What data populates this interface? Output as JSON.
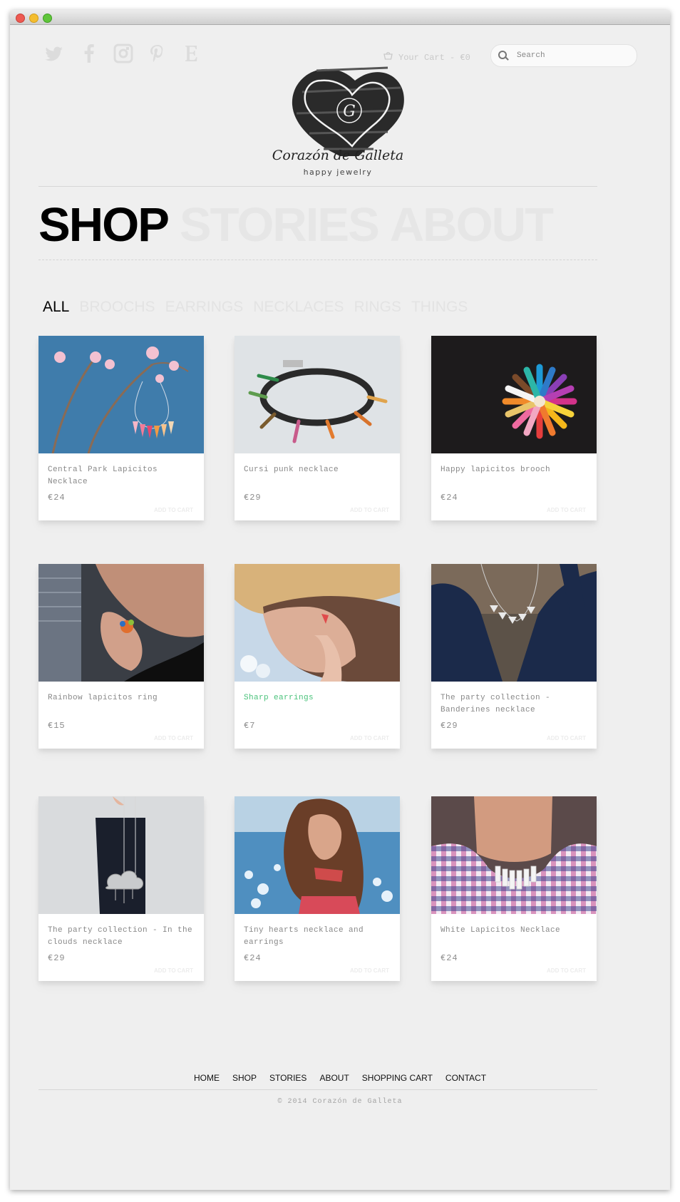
{
  "social": [
    {
      "icon": "twitter-icon",
      "glyph": "t"
    },
    {
      "icon": "facebook-icon",
      "glyph": "f"
    },
    {
      "icon": "instagram-icon",
      "glyph": "◘"
    },
    {
      "icon": "pinterest-icon",
      "glyph": "p"
    },
    {
      "icon": "etsy-icon",
      "glyph": "E"
    }
  ],
  "cart": {
    "label": "Your Cart - €0",
    "icon": "basket-icon"
  },
  "search": {
    "placeholder": "Search"
  },
  "brand": {
    "name": "Corazón de Galleta",
    "tagline": "happy jewelry",
    "monogram": "G"
  },
  "nav": {
    "shop": "SHOP",
    "stories": "STORIES",
    "about": "ABOUT"
  },
  "filters": [
    "ALL",
    "BROOCHS",
    "EARRINGS",
    "NECKLACES",
    "RINGS",
    "THINGS"
  ],
  "products": [
    {
      "title": "Central Park Lapicitos Necklace",
      "price": "€24",
      "add": "ADD TO CART"
    },
    {
      "title": "Cursi punk necklace",
      "price": "€29",
      "add": "ADD TO CART"
    },
    {
      "title": "Happy lapicitos brooch",
      "price": "€24",
      "add": "ADD TO CART"
    },
    {
      "title": "Rainbow lapicitos ring",
      "price": "€15",
      "add": "ADD TO CART"
    },
    {
      "title": "Sharp earrings",
      "price": "€7",
      "add": "ADD TO CART"
    },
    {
      "title": "The party collection - Banderines necklace",
      "price": "€29",
      "add": "ADD TO CART"
    },
    {
      "title": "The party collection - In the clouds necklace",
      "price": "€29",
      "add": "ADD TO CART"
    },
    {
      "title": "Tiny hearts necklace and earrings",
      "price": "€24",
      "add": "ADD TO CART"
    },
    {
      "title": "White Lapicitos Necklace",
      "price": "€24",
      "add": "ADD TO CART"
    }
  ],
  "footer": {
    "links": [
      "HOME",
      "SHOP",
      "STORIES",
      "ABOUT",
      "SHOPPING CART",
      "CONTACT"
    ],
    "copyright": "© 2014 Corazón de Galleta"
  },
  "colors": {
    "highlight": "#49c27a",
    "background": "#efefef"
  }
}
